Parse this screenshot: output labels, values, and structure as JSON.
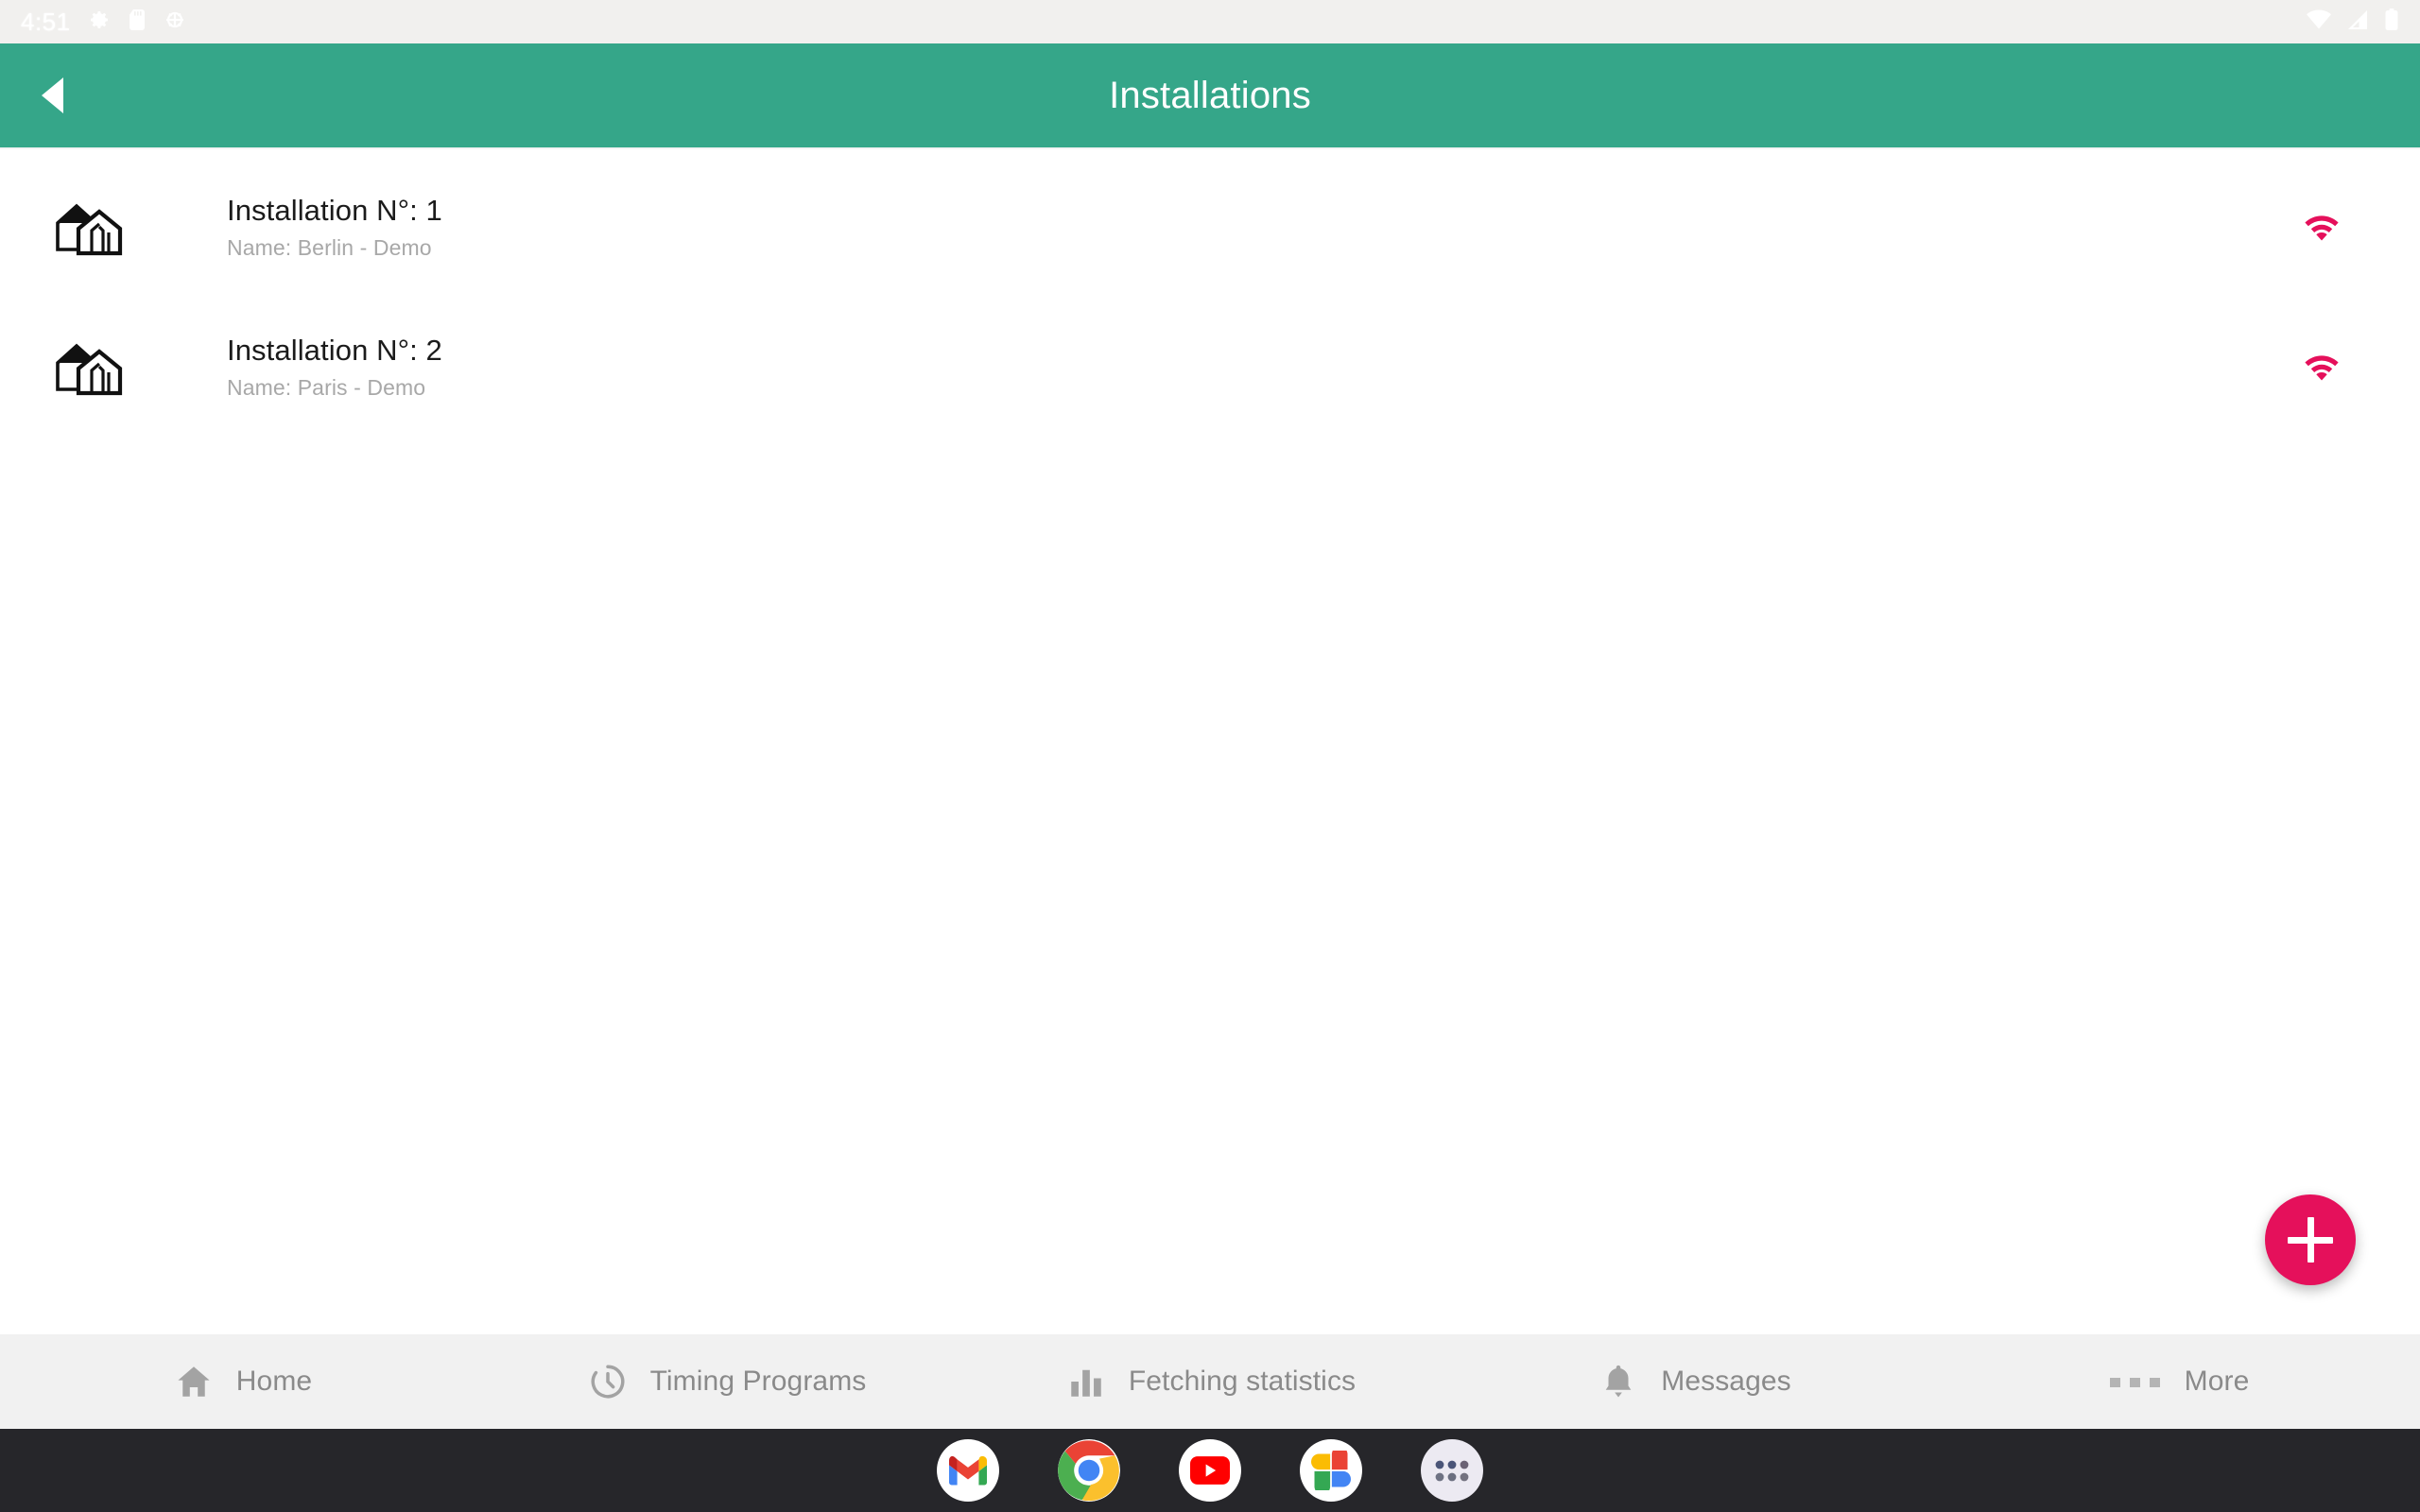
{
  "statusbar": {
    "time": "4:51",
    "left_icons": [
      "gear-icon",
      "sd-card-icon",
      "developer-mode-icon"
    ],
    "right_icons": [
      "wifi-icon",
      "cell-signal-icon",
      "battery-icon"
    ]
  },
  "appbar": {
    "back_label": "back-arrow-icon",
    "title": "Installations",
    "color": "#35a689"
  },
  "installations": [
    {
      "icon": "greenhouse-icon",
      "title": "Installation N°: 1",
      "subtitle": "Name: Berlin - Demo",
      "status_icon": "wifi-connected-icon",
      "status_color": "#e5105b"
    },
    {
      "icon": "greenhouse-icon",
      "title": "Installation N°: 2",
      "subtitle": "Name: Paris - Demo",
      "status_icon": "wifi-connected-icon",
      "status_color": "#e5105b"
    }
  ],
  "fab": {
    "label": "+",
    "name": "add-installation-button",
    "color": "#e5105b"
  },
  "bottomnav": {
    "items": [
      {
        "label": "Home",
        "icon": "home-icon"
      },
      {
        "label": "Timing Programs",
        "icon": "clock-history-icon"
      },
      {
        "label": "Fetching statistics",
        "icon": "bar-chart-icon"
      },
      {
        "label": "Messages",
        "icon": "bell-icon"
      },
      {
        "label": "More",
        "icon": "more-dots-icon"
      }
    ],
    "color": "#f1f1f1",
    "label_color": "#8a8a8a"
  },
  "dock": {
    "apps": [
      {
        "name": "gmail"
      },
      {
        "name": "chrome"
      },
      {
        "name": "youtube"
      },
      {
        "name": "google-photos"
      },
      {
        "name": "app-drawer"
      }
    ],
    "color": "#26262a"
  }
}
